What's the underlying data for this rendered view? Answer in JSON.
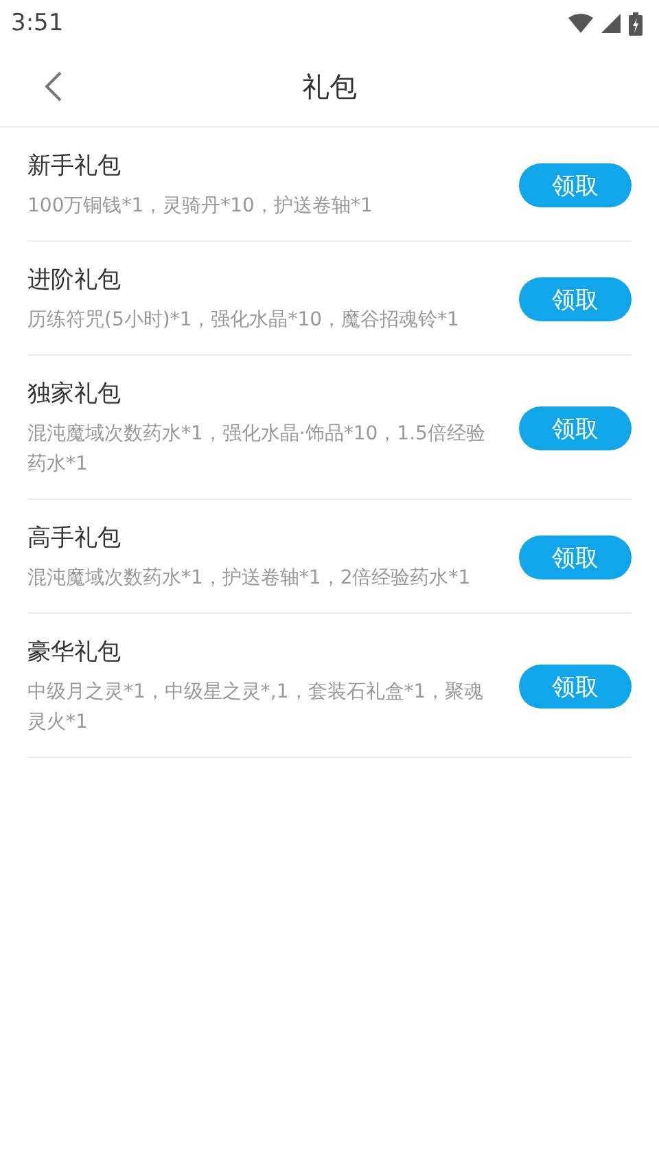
{
  "status_bar": {
    "time": "3:51"
  },
  "header": {
    "title": "礼包"
  },
  "packs": [
    {
      "name": "新手礼包",
      "contents": "100万铜钱*1，灵骑丹*10，护送卷轴*1",
      "button": "领取"
    },
    {
      "name": "进阶礼包",
      "contents": "历练符咒(5小时)*1，强化水晶*10，魔谷招魂铃*1",
      "button": "领取"
    },
    {
      "name": "独家礼包",
      "contents": "混沌魔域次数药水*1，强化水晶·饰品*10，1.5倍经验药水*1",
      "button": "领取"
    },
    {
      "name": "高手礼包",
      "contents": "混沌魔域次数药水*1，护送卷轴*1，2倍经验药水*1",
      "button": "领取"
    },
    {
      "name": "豪华礼包",
      "contents": "中级月之灵*1，中级星之灵*,1，套装石礼盒*1，聚魂灵火*1",
      "button": "领取"
    }
  ]
}
